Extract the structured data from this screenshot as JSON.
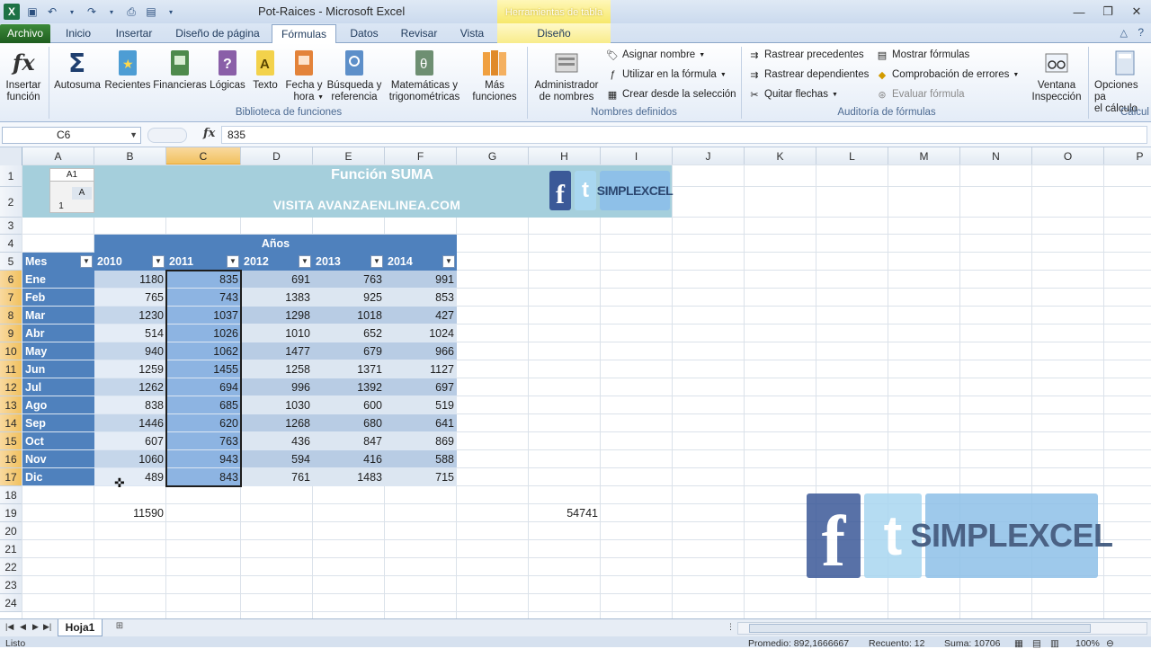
{
  "window": {
    "title": "Pot-Raices  -  Microsoft Excel",
    "context_tab_title": "Herramientas de tabla"
  },
  "tabs": [
    {
      "label": "Archivo"
    },
    {
      "label": "Inicio"
    },
    {
      "label": "Insertar"
    },
    {
      "label": "Diseño de página"
    },
    {
      "label": "Fórmulas"
    },
    {
      "label": "Datos"
    },
    {
      "label": "Revisar"
    },
    {
      "label": "Vista"
    },
    {
      "label": "Diseño"
    }
  ],
  "ribbon": {
    "insert_function": "Insertar\nfunción",
    "library": [
      {
        "label": "Autosuma"
      },
      {
        "label": "Recientes"
      },
      {
        "label": "Financieras"
      },
      {
        "label": "Lógicas"
      },
      {
        "label": "Texto"
      },
      {
        "label": "Fecha y\nhora"
      },
      {
        "label": "Búsqueda y\nreferencia"
      },
      {
        "label": "Matemáticas y\ntrigonométricas"
      },
      {
        "label": "Más\nfunciones"
      }
    ],
    "library_group": "Biblioteca de funciones",
    "name_manager": "Administrador\nde nombres",
    "define_name": "Asignar nombre",
    "use_in_formula": "Utilizar en la fórmula",
    "create_from_selection": "Crear desde la selección",
    "names_group": "Nombres definidos",
    "trace_precedents": "Rastrear precedentes",
    "trace_dependents": "Rastrear dependientes",
    "remove_arrows": "Quitar flechas",
    "show_formulas": "Mostrar fórmulas",
    "error_checking": "Comprobación de errores",
    "evaluate_formula": "Evaluar fórmula",
    "auditing_group": "Auditoría de fórmulas",
    "watch_window": "Ventana\nInspección",
    "calc_options": "Opciones pa\nel cálculo",
    "calc_group": "Cálcul"
  },
  "formula_bar": {
    "name_box": "C6",
    "fx": "fx",
    "value": "835"
  },
  "columns": [
    "A",
    "B",
    "C",
    "D",
    "E",
    "F",
    "G",
    "H",
    "I",
    "J",
    "K",
    "L",
    "M",
    "N",
    "O",
    "P"
  ],
  "rows": [
    "1",
    "2",
    "3",
    "4",
    "5",
    "6",
    "7",
    "8",
    "9",
    "10",
    "11",
    "12",
    "13",
    "14",
    "15",
    "16",
    "17",
    "18",
    "19",
    "20",
    "21",
    "22",
    "23",
    "24"
  ],
  "banner": {
    "title": "Función SUMA",
    "subtitle": "VISITA AVANZAENLINEA.COM",
    "mini_namebox": "A1",
    "mini_col": "A",
    "mini_row": "1",
    "fb": "f",
    "tw": "t",
    "logo_text": "SIMPLEXCEL"
  },
  "table": {
    "group_header": "Años",
    "headers": [
      "Mes",
      "2010",
      "2011",
      "2012",
      "2013",
      "2014"
    ],
    "rows": [
      {
        "mes": "Ene",
        "v": [
          "1180",
          "835",
          "691",
          "763",
          "991"
        ]
      },
      {
        "mes": "Feb",
        "v": [
          "765",
          "743",
          "1383",
          "925",
          "853"
        ]
      },
      {
        "mes": "Mar",
        "v": [
          "1230",
          "1037",
          "1298",
          "1018",
          "427"
        ]
      },
      {
        "mes": "Abr",
        "v": [
          "514",
          "1026",
          "1010",
          "652",
          "1024"
        ]
      },
      {
        "mes": "May",
        "v": [
          "940",
          "1062",
          "1477",
          "679",
          "966"
        ]
      },
      {
        "mes": "Jun",
        "v": [
          "1259",
          "1455",
          "1258",
          "1371",
          "1127"
        ]
      },
      {
        "mes": "Jul",
        "v": [
          "1262",
          "694",
          "996",
          "1392",
          "697"
        ]
      },
      {
        "mes": "Ago",
        "v": [
          "838",
          "685",
          "1030",
          "600",
          "519"
        ]
      },
      {
        "mes": "Sep",
        "v": [
          "1446",
          "620",
          "1268",
          "680",
          "641"
        ]
      },
      {
        "mes": "Oct",
        "v": [
          "607",
          "763",
          "436",
          "847",
          "869"
        ]
      },
      {
        "mes": "Nov",
        "v": [
          "1060",
          "943",
          "594",
          "416",
          "588"
        ]
      },
      {
        "mes": "Dic",
        "v": [
          "489",
          "843",
          "761",
          "1483",
          "715"
        ]
      }
    ],
    "sum_b19": "11590",
    "sum_h19": "54741"
  },
  "sheets": {
    "active": "Hoja1"
  },
  "status": {
    "ready": "Listo",
    "average": "Promedio: 892,1666667",
    "count": "Recuento: 12",
    "sum": "Suma: 10706",
    "zoom": "100%"
  },
  "colors": {
    "header_blue": "#4f81bd",
    "band_light": "#dce6f1",
    "band_mid": "#b8cce4",
    "selection": "#8db4e2"
  }
}
